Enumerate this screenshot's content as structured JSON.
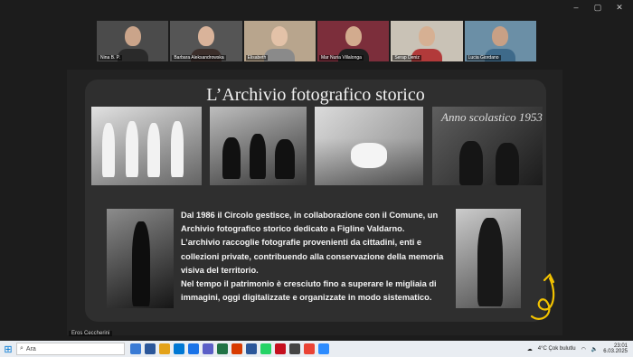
{
  "window": {
    "minimize": "–",
    "maximize": "▢",
    "close": "✕"
  },
  "participants": [
    {
      "name": "Nina B. P.",
      "face": "#caa48a",
      "shirt": "#2a2a2a",
      "bg": "#4b4b4b"
    },
    {
      "name": "Barbara Aleksandrowska",
      "face": "#d9b39a",
      "shirt": "#3b2e2a",
      "bg": "#555"
    },
    {
      "name": "Elisabeth",
      "face": "#e3c2a8",
      "shirt": "#8a8a8a",
      "bg": "#b8a58d"
    },
    {
      "name": "Mar Nuria Villalonga",
      "face": "#d2ab8e",
      "shirt": "#1f1f1f",
      "bg": "#7c2e3b"
    },
    {
      "name": "Serap Deniz",
      "face": "#d6b093",
      "shirt": "#b23a3a",
      "bg": "#c9c2b6"
    },
    {
      "name": "Lucia Giordano",
      "face": "#c8a085",
      "shirt": "#3e6a8a",
      "bg": "#6b8fa6"
    }
  ],
  "slide": {
    "title": "L’Archivio fotografico storico",
    "chalkboard": "Anno scolastico 1953",
    "paragraphs": [
      "Dal 1986 il Circolo gestisce, in collaborazione con il Comune, un Archivio fotografico storico dedicato a Figline Valdarno.",
      "L’archivio raccoglie fotografie provenienti da cittadini, enti e collezioni private, contribuendo alla conservazione della memoria visiva del territorio.",
      "Nel tempo il patrimonio è cresciuto fino a superare le migliaia di immagini, oggi digitalizzate e organizzate in modo sistematico."
    ],
    "accent": "#f2c200"
  },
  "speaker_label": "Eros Ceccherini",
  "taskbar": {
    "search_placeholder": "Ara",
    "weather": "4°C Çok bulutlu",
    "time": "23:01",
    "date": "6.03.2025",
    "apps": [
      "#3a7bd5",
      "#2b579a",
      "#e3a21a",
      "#0078d4",
      "#1a73e8",
      "#5b5fc7",
      "#217346",
      "#d83b01",
      "#2b579a",
      "#25d366",
      "#c50f1f",
      "#444",
      "#ea4335",
      "#2d8cff"
    ]
  }
}
